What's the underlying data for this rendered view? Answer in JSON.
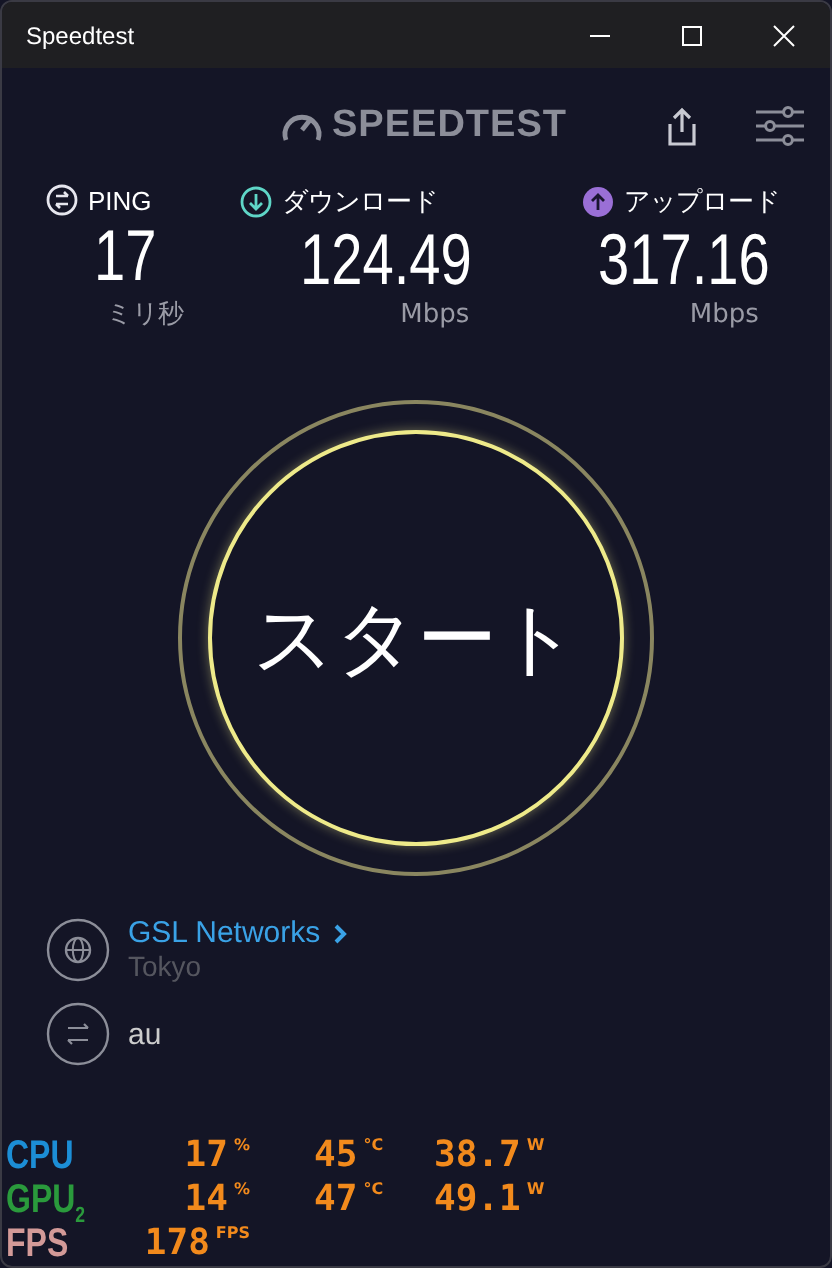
{
  "window": {
    "title": "Speedtest"
  },
  "header": {
    "logo": "SPEEDTEST"
  },
  "metrics": [
    {
      "kind": "ping",
      "label": "PING",
      "value": "17",
      "unit": "ミリ秒"
    },
    {
      "kind": "download",
      "label": "ダウンロード",
      "value": "124.49",
      "unit": "Mbps"
    },
    {
      "kind": "upload",
      "label": "アップロード",
      "value": "317.16",
      "unit": "Mbps"
    }
  ],
  "start_button": {
    "label": "スタート"
  },
  "server": {
    "name": "GSL Networks",
    "location": "Tokyo"
  },
  "provider": {
    "name": "au"
  },
  "overlay": {
    "rows": [
      {
        "label": "CPU",
        "color": "#1c8ed6",
        "readings": [
          {
            "value": "17",
            "unit": "%"
          },
          {
            "value": "45",
            "unit": "°C"
          },
          {
            "value": "38.7",
            "unit": "W"
          }
        ]
      },
      {
        "label": "GPU$_{2}$",
        "color": "#2a9a3c",
        "readings": [
          {
            "value": "14",
            "unit": "%"
          },
          {
            "value": "47",
            "unit": "°C"
          },
          {
            "value": "49.1",
            "unit": "W"
          }
        ]
      },
      {
        "label": "FPS",
        "color": "#d39a98",
        "readings": [
          {
            "value": "178",
            "unit": "FPS"
          }
        ]
      }
    ]
  }
}
